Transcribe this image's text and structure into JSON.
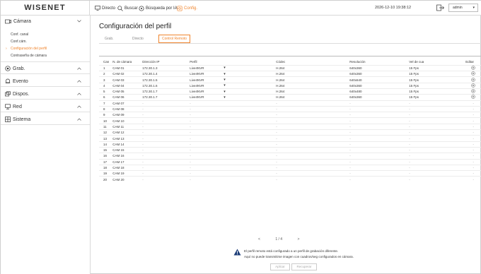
{
  "header": {
    "logo": "WISENET",
    "nav": {
      "live": "Directo",
      "search": "Buscar",
      "ai_search": "Búsqueda por IA",
      "setup": "Config."
    },
    "datetime": "2026-12-10 19:38:12",
    "user": "admin"
  },
  "sidebar": {
    "camera": {
      "label": "Cámara",
      "items": [
        "Conf. canal",
        "Conf.cám.",
        "Configuración del perfil",
        "Contraseña de cámara"
      ]
    },
    "groups": [
      "Grab.",
      "Evento",
      "Dispos.",
      "Red",
      "Sistema"
    ]
  },
  "main": {
    "title": "Configuración del perfil",
    "tabs": [
      "Grab.",
      "Directo",
      "Control Remoto"
    ],
    "columns": [
      "Can",
      "N. de cámara",
      "Dirección IP",
      "Perfil",
      "Códec",
      "Resolución",
      "Vel de cua",
      "Editar"
    ],
    "rows": [
      {
        "ch": "1",
        "name": "CAM 01",
        "ip": "172.30.1.3",
        "profile": "Live4NVR",
        "codec": "H.264",
        "res": "640x360",
        "fps": "15 Fps"
      },
      {
        "ch": "2",
        "name": "CAM 02",
        "ip": "172.30.1.4",
        "profile": "Live4NVR",
        "codec": "H.264",
        "res": "640x360",
        "fps": "15 Fps"
      },
      {
        "ch": "3",
        "name": "CAM 03",
        "ip": "172.30.1.5",
        "profile": "Live4NVR",
        "codec": "H.264",
        "res": "640x640",
        "fps": "15 Fps"
      },
      {
        "ch": "4",
        "name": "CAM 04",
        "ip": "172.30.1.6",
        "profile": "Live4NVR",
        "codec": "H.264",
        "res": "640x360",
        "fps": "15 Fps"
      },
      {
        "ch": "5",
        "name": "CAM 05",
        "ip": "172.30.1.7",
        "profile": "Live4NVR",
        "codec": "H.264",
        "res": "640x480",
        "fps": "15 Fps"
      },
      {
        "ch": "6",
        "name": "CAM 06",
        "ip": "172.30.1.7",
        "profile": "Live4NVR",
        "codec": "H.264",
        "res": "640x360",
        "fps": "15 Fps"
      },
      {
        "ch": "7",
        "name": "CAM 07"
      },
      {
        "ch": "8",
        "name": "CAM 08"
      },
      {
        "ch": "9",
        "name": "CAM 09"
      },
      {
        "ch": "10",
        "name": "CAM 10"
      },
      {
        "ch": "11",
        "name": "CAM 11"
      },
      {
        "ch": "12",
        "name": "CAM 12"
      },
      {
        "ch": "13",
        "name": "CAM 13"
      },
      {
        "ch": "14",
        "name": "CAM 14"
      },
      {
        "ch": "15",
        "name": "CAM 15"
      },
      {
        "ch": "16",
        "name": "CAM 16"
      },
      {
        "ch": "17",
        "name": "CAM 17"
      },
      {
        "ch": "18",
        "name": "CAM 18"
      },
      {
        "ch": "19",
        "name": "CAM 19"
      },
      {
        "ch": "20",
        "name": "CAM 20"
      }
    ],
    "empty_value": "-",
    "pagination": {
      "prev": "<",
      "page": "1 / 4",
      "next": ">"
    },
    "note_line1": "El perfil remoto está configurado a un perfil de grabación diferente.",
    "note_line2": "Aquí no puede transmitirse imagen con cuadros/seg configurados en cámara.",
    "buttons": {
      "apply": "Aplicar",
      "restore": "Recuperar"
    }
  },
  "colors": {
    "accent": "#f0842c",
    "warning": "#1d3e78"
  }
}
